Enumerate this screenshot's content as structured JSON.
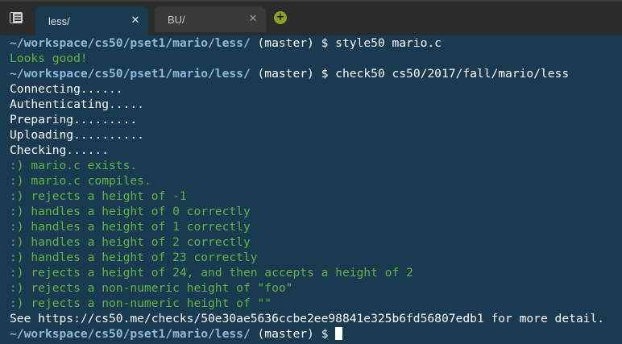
{
  "tabs": [
    {
      "label": "less/",
      "active": true
    },
    {
      "label": "BU/",
      "active": false
    }
  ],
  "icons": {
    "menu": "menu-icon",
    "close": "close-icon",
    "add": "add-tab-icon"
  },
  "colors": {
    "terminal_bg": "#1a3a52",
    "path": "#8fbad9",
    "success": "#5fb544",
    "text": "#ffffff",
    "add_button": "#8aa31c"
  },
  "terminal": {
    "prompt_path": "~/workspace/cs50/pset1/mario/less/",
    "prompt_branch": " (master) $ ",
    "cmd1": "style50 mario.c",
    "style_result": "Looks good!",
    "cmd2": "check50 cs50/2017/fall/mario/less",
    "progress": [
      "Connecting......",
      "Authenticating.....",
      "Preparing.........",
      "Uploading..........",
      "Checking......"
    ],
    "results": [
      ":) mario.c exists.",
      ":) mario.c compiles.",
      ":) rejects a height of -1",
      ":) handles a height of 0 correctly",
      ":) handles a height of 1 correctly",
      ":) handles a height of 2 correctly",
      ":) handles a height of 23 correctly",
      ":) rejects a height of 24, and then accepts a height of 2",
      ":) rejects a non-numeric height of \"foo\"",
      ":) rejects a non-numeric height of \"\""
    ],
    "see_more": "See https://cs50.me/checks/50e30ae5636ccbe2ee98841e325b6fd56807edb1 for more detail."
  }
}
